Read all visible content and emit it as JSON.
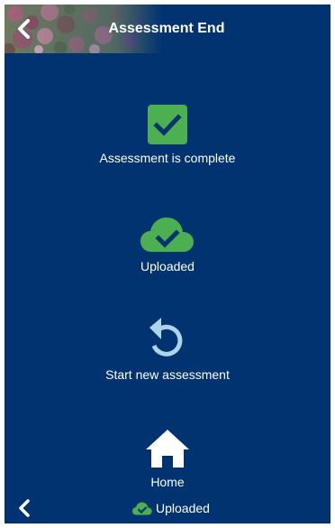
{
  "header": {
    "title": "Assessment End",
    "back_icon": "chevron-left-icon"
  },
  "actions": [
    {
      "id": "complete",
      "icon": "checkbox-checked-icon",
      "label": "Assessment is complete",
      "color": "#4caf50"
    },
    {
      "id": "uploaded",
      "icon": "cloud-check-icon",
      "label": "Uploaded",
      "color": "#4caf50"
    },
    {
      "id": "restart",
      "icon": "restart-icon",
      "label": "Start new assessment",
      "color": "#aed4ec"
    },
    {
      "id": "home",
      "icon": "home-icon",
      "label": "Home",
      "color": "#ffffff"
    }
  ],
  "footer": {
    "back_icon": "chevron-left-icon",
    "status_icon": "cloud-check-icon",
    "status_label": "Uploaded"
  },
  "colors": {
    "background": "#003370",
    "accent_green": "#4caf50",
    "text": "#ffffff"
  }
}
